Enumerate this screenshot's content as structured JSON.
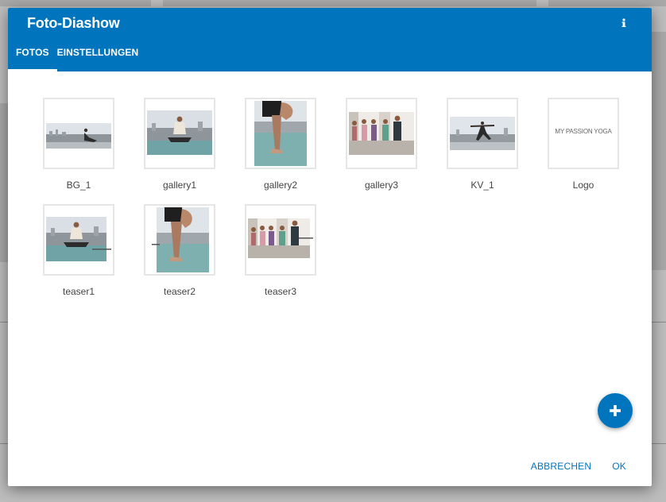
{
  "dialog": {
    "title": "Foto-Diashow",
    "info_icon": "info-icon",
    "accent_color": "#0174be"
  },
  "tabs": [
    {
      "label": "FOTOS",
      "active": true
    },
    {
      "label": "EINSTELLUNGEN",
      "active": false
    }
  ],
  "photos": [
    {
      "label": "BG_1"
    },
    {
      "label": "gallery1"
    },
    {
      "label": "gallery2"
    },
    {
      "label": "gallery3"
    },
    {
      "label": "KV_1"
    },
    {
      "label": "Logo",
      "logo_text": "MY PASSION YOGA"
    },
    {
      "label": "teaser1"
    },
    {
      "label": "teaser2"
    },
    {
      "label": "teaser3"
    }
  ],
  "fab": {
    "icon": "plus-icon"
  },
  "actions": {
    "cancel_label": "ABBRECHEN",
    "ok_label": "OK"
  }
}
